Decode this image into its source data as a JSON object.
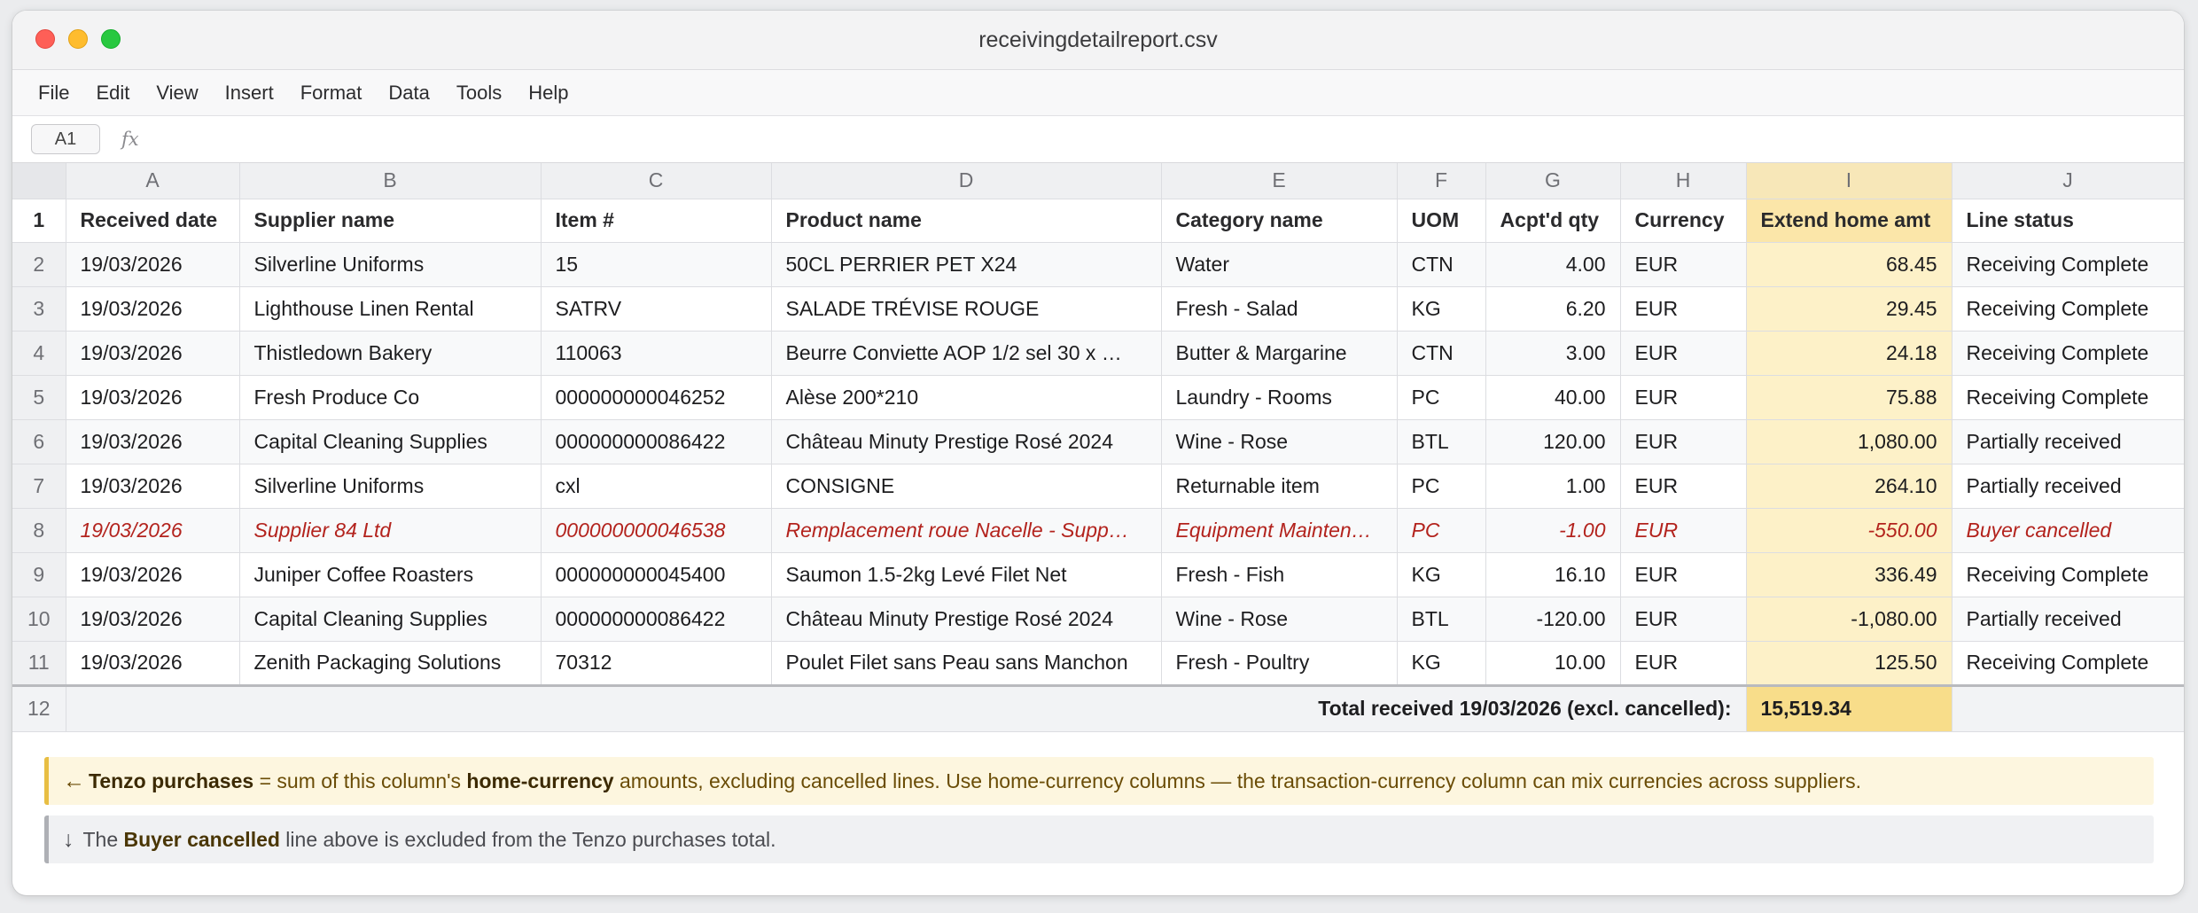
{
  "window": {
    "title": "receivingdetailreport.csv"
  },
  "menu": [
    "File",
    "Edit",
    "View",
    "Insert",
    "Format",
    "Data",
    "Tools",
    "Help"
  ],
  "formula_bar": {
    "cell_ref": "A1",
    "fx_label": "fx",
    "value": ""
  },
  "columns": [
    "A",
    "B",
    "C",
    "D",
    "E",
    "F",
    "G",
    "H",
    "I",
    "J"
  ],
  "header_row": {
    "row_number": "1",
    "cells": [
      "Received date",
      "Supplier name",
      "Item #",
      "Product name",
      "Category name",
      "UOM",
      "Acpt'd qty",
      "Currency",
      "Extend home amt",
      "Line status"
    ]
  },
  "rows": [
    {
      "n": "2",
      "cells": [
        "19/03/2026",
        "Silverline Uniforms",
        "15",
        "50CL PERRIER PET X24",
        "Water",
        "CTN",
        "4.00",
        "EUR",
        "68.45",
        "Receiving Complete"
      ]
    },
    {
      "n": "3",
      "cells": [
        "19/03/2026",
        "Lighthouse Linen Rental",
        "SATRV",
        "SALADE TRÉVISE ROUGE",
        "Fresh - Salad",
        "KG",
        "6.20",
        "EUR",
        "29.45",
        "Receiving Complete"
      ]
    },
    {
      "n": "4",
      "cells": [
        "19/03/2026",
        "Thistledown Bakery",
        "110063",
        "Beurre Conviette AOP 1/2 sel 30 x …",
        "Butter & Margarine",
        "CTN",
        "3.00",
        "EUR",
        "24.18",
        "Receiving Complete"
      ]
    },
    {
      "n": "5",
      "cells": [
        "19/03/2026",
        "Fresh Produce Co",
        "000000000046252",
        "Alèse 200*210",
        "Laundry - Rooms",
        "PC",
        "40.00",
        "EUR",
        "75.88",
        "Receiving Complete"
      ]
    },
    {
      "n": "6",
      "cells": [
        "19/03/2026",
        "Capital Cleaning Supplies",
        "000000000086422",
        "Château Minuty Prestige Rosé 2024",
        "Wine - Rose",
        "BTL",
        "120.00",
        "EUR",
        "1,080.00",
        "Partially received"
      ]
    },
    {
      "n": "7",
      "cells": [
        "19/03/2026",
        "Silverline Uniforms",
        "cxl",
        "CONSIGNE",
        "Returnable item",
        "PC",
        "1.00",
        "EUR",
        "264.10",
        "Partially received"
      ]
    },
    {
      "n": "8",
      "cells": [
        "19/03/2026",
        "Supplier 84 Ltd",
        "000000000046538",
        "Remplacement roue Nacelle - Supp…",
        "Equipment Mainten…",
        "PC",
        "-1.00",
        "EUR",
        "-550.00",
        "Buyer cancelled"
      ],
      "cancelled": true
    },
    {
      "n": "9",
      "cells": [
        "19/03/2026",
        "Juniper Coffee Roasters",
        "000000000045400",
        "Saumon 1.5-2kg Levé Filet Net",
        "Fresh - Fish",
        "KG",
        "16.10",
        "EUR",
        "336.49",
        "Receiving Complete"
      ]
    },
    {
      "n": "10",
      "cells": [
        "19/03/2026",
        "Capital Cleaning Supplies",
        "000000000086422",
        "Château Minuty Prestige Rosé 2024",
        "Wine - Rose",
        "BTL",
        "-120.00",
        "EUR",
        "-1,080.00",
        "Partially received"
      ]
    },
    {
      "n": "11",
      "cells": [
        "19/03/2026",
        "Zenith Packaging Solutions",
        "70312",
        "Poulet Filet sans Peau sans Manchon",
        "Fresh - Poultry",
        "KG",
        "10.00",
        "EUR",
        "125.50",
        "Receiving Complete"
      ]
    }
  ],
  "total_row": {
    "n": "12",
    "label": "Total received 19/03/2026 (excl. cancelled):",
    "value": "15,519.34"
  },
  "notes": {
    "note1": {
      "arrow": "←",
      "b1": "Tenzo purchases",
      "t1": " = sum of this column's ",
      "b2": "home-currency",
      "t2": " amounts, excluding cancelled lines. Use home-currency columns — the transaction-currency column can mix currencies across suppliers."
    },
    "note2": {
      "arrow": "↓",
      "t1": " The ",
      "b1": "Buyer cancelled",
      "t2": " line above is excluded from the Tenzo purchases total."
    }
  },
  "colors": {
    "highlight_column": "#fdf1c8",
    "total_value": "#f8dd8a",
    "cancelled_text": "#b3231d",
    "note_yellow_border": "#e8be43"
  }
}
